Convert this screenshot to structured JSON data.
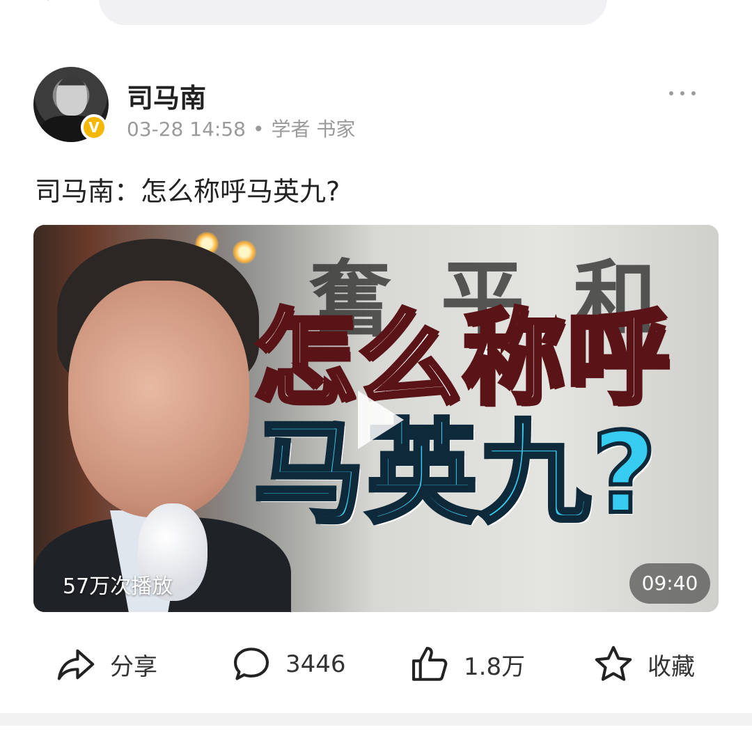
{
  "top_bar": {
    "search_placeholder": ""
  },
  "post": {
    "author": {
      "name": "司马南",
      "avatar_icon": "author-avatar",
      "verified_badge": "V",
      "verified_color": "#f5b800"
    },
    "meta": {
      "timestamp": "03-28 14:58",
      "separator": "•",
      "tags": "学者 书家"
    },
    "title": "司马南：怎么称呼马英九?",
    "video": {
      "overlay_line1": "怎么称呼",
      "overlay_line2": "马英九?",
      "background_text": "奮平和",
      "play_count": "57万次播放",
      "duration": "09:40",
      "overlay_accent_color": "#37cdf2"
    }
  },
  "actions": {
    "share": {
      "icon": "share-icon",
      "label": "分享"
    },
    "comment": {
      "icon": "comment-icon",
      "label": "3446"
    },
    "like": {
      "icon": "thumbs-up-icon",
      "label": "1.8万"
    },
    "favorite": {
      "icon": "star-icon",
      "label": "收藏"
    }
  }
}
